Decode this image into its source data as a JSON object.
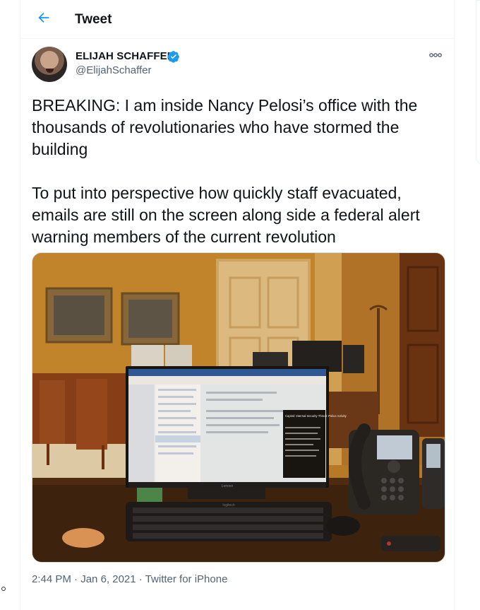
{
  "header": {
    "back_icon": "arrow-left-icon",
    "title": "Tweet"
  },
  "tweet": {
    "author_name": "ELIJAH SCHAFFER",
    "author_handle": "@ElijahSchaffer",
    "verified_icon": "verified-badge-icon",
    "more_icon": "more-options-icon",
    "paragraphs": [
      "BREAKING: I am inside Nancy Pelosi’s office with the thousands of revolutionaries who have stormed the building",
      "To put into perspective how quickly staff evacuated, emails are still on the screen along side a federal alert warning members of the current revolution"
    ],
    "time": "2:44 PM",
    "separator": " · ",
    "date": "Jan 6, 2021",
    "source": "Twitter for iPhone"
  },
  "photo_text": {
    "alert_title": "Capitol: Internal Security Threat: Police Activity",
    "monitor_brand": "Lenovo",
    "keyboard_brand": "logitech"
  },
  "colors": {
    "accent": "#1d9bf0",
    "text": "#0f1419",
    "secondary": "#536471",
    "border": "#eff3f4"
  }
}
